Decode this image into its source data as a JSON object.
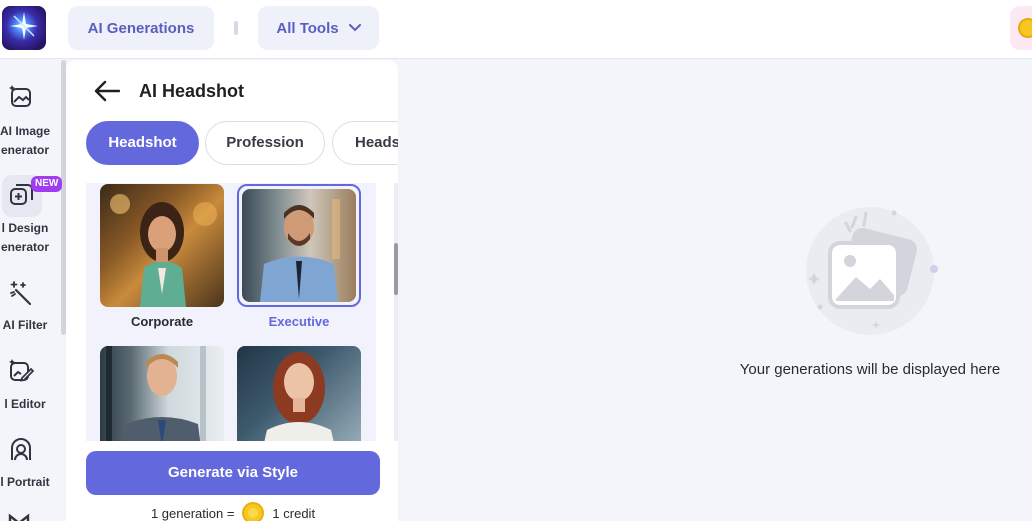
{
  "topbar": {
    "generations_label": "AI Generations",
    "all_tools_label": "All Tools"
  },
  "leftnav": {
    "items": [
      {
        "label": "AI Image\nGenerator",
        "line1": "AI Image",
        "line2": "enerator",
        "icon": "image-sparkle-icon"
      },
      {
        "label": "AI Design Generator",
        "line1": "l Design",
        "line2": "enerator",
        "icon": "design-plus-icon",
        "badge": "NEW"
      },
      {
        "label": "AI Filter",
        "line1": "AI Filter",
        "icon": "magic-wand-icon"
      },
      {
        "label": "AI Editor",
        "line1": "l Editor",
        "icon": "image-edit-icon"
      },
      {
        "label": "AI Portrait",
        "line1": "l Portrait",
        "icon": "portrait-icon"
      }
    ]
  },
  "panel": {
    "title": "AI Headshot",
    "tabs": [
      "Headshot",
      "Profession",
      "Heads"
    ],
    "styles": [
      {
        "caption": "Corporate",
        "selected": false
      },
      {
        "caption": "Executive",
        "selected": true
      },
      {
        "caption": "",
        "selected": false
      },
      {
        "caption": "",
        "selected": false
      }
    ],
    "generate_label": "Generate via Style",
    "cost_left": "1 generation =",
    "cost_right": "1 credit"
  },
  "main": {
    "empty_text": "Your generations will be displayed here"
  },
  "colors": {
    "accent": "#6369dc",
    "badge": "#9f3df0",
    "coin": "#f7c623"
  }
}
